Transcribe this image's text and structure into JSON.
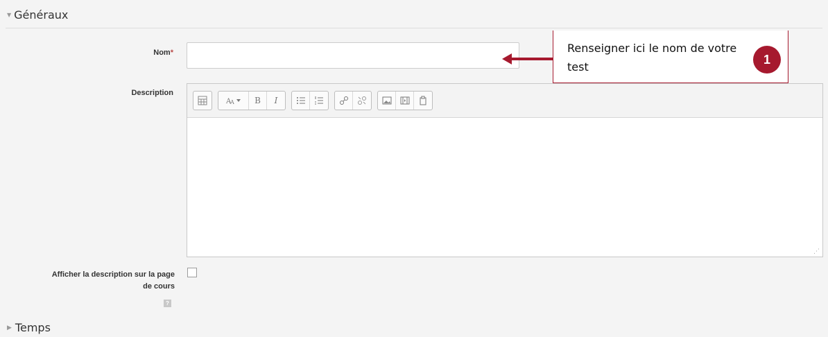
{
  "sections": {
    "general": {
      "title": "Généraux",
      "expanded": true
    },
    "time": {
      "title": "Temps",
      "expanded": false
    }
  },
  "fields": {
    "name": {
      "label": "Nom",
      "required_marker": "*",
      "value": ""
    },
    "description": {
      "label": "Description",
      "value": ""
    },
    "show_description": {
      "label_line1": "Afficher la description sur la page",
      "label_line2": "de cours",
      "checked": false
    }
  },
  "callout": {
    "text": "Renseigner ici le nom de votre test",
    "badge": "1",
    "color": "#a6192e"
  },
  "toolbar": {
    "groups": [
      [
        "toggle-toolbar-icon"
      ],
      [
        "font-size-icon",
        "bold-icon",
        "italic-icon"
      ],
      [
        "bulleted-list-icon",
        "numbered-list-icon"
      ],
      [
        "link-icon",
        "unlink-icon"
      ],
      [
        "image-icon",
        "media-icon",
        "paste-icon"
      ]
    ],
    "bold_label": "B",
    "italic_label": "I"
  },
  "icons": {
    "help": "?"
  }
}
